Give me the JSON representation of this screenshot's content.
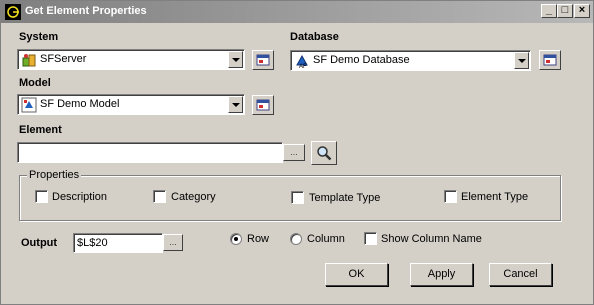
{
  "window": {
    "title": "Get Element Properties",
    "icon": "app-icon",
    "controls": {
      "minimize": "_",
      "maximize": "□",
      "close": "×"
    }
  },
  "system": {
    "label": "System",
    "value": "SFServer",
    "icon": "server-icon",
    "browse_icon": "connection-manager-icon"
  },
  "database": {
    "label": "Database",
    "value": "SF Demo Database",
    "icon": "database-icon",
    "browse_icon": "connection-manager-icon"
  },
  "model": {
    "label": "Model",
    "value": "SF Demo Model",
    "icon": "model-icon",
    "browse_icon": "connection-manager-icon"
  },
  "element": {
    "label": "Element",
    "value": "",
    "browse_label": "...",
    "search_icon": "magnifier-icon"
  },
  "properties": {
    "legend": "Properties",
    "options": [
      {
        "label": "Description",
        "checked": false
      },
      {
        "label": "Category",
        "checked": false
      },
      {
        "label": "Template Type",
        "checked": false
      },
      {
        "label": "Element Type",
        "checked": false
      }
    ]
  },
  "output": {
    "label": "Output",
    "value": "$L$20",
    "browse_label": "...",
    "orientation": [
      {
        "label": "Row",
        "selected": true
      },
      {
        "label": "Column",
        "selected": false
      }
    ],
    "show_column_name": {
      "label": "Show Column Name",
      "checked": false
    }
  },
  "buttons": {
    "ok": "OK",
    "apply": "Apply",
    "cancel": "Cancel"
  }
}
